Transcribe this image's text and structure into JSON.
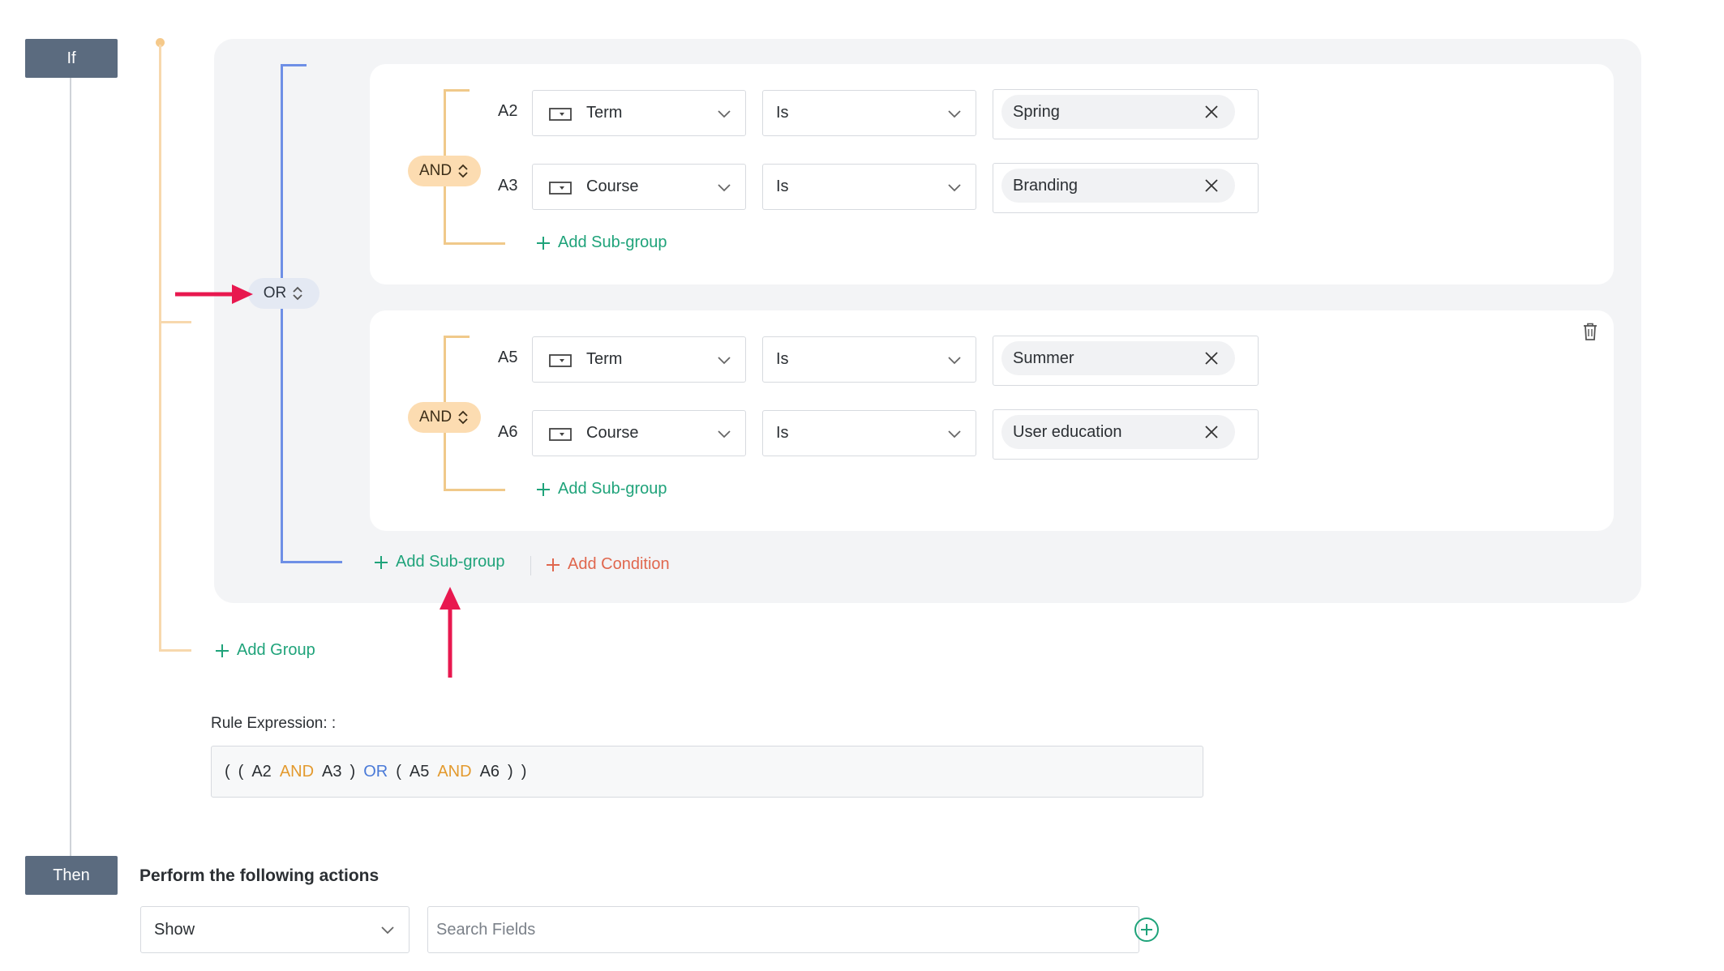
{
  "if_label": "If",
  "then_label": "Then",
  "or_operator": "OR",
  "groups": [
    {
      "operator": "AND",
      "conditions": [
        {
          "id": "A2",
          "field": "Term",
          "comparator": "Is",
          "value": "Spring"
        },
        {
          "id": "A3",
          "field": "Course",
          "comparator": "Is",
          "value": "Branding"
        }
      ],
      "add_subgroup": "Add Sub-group"
    },
    {
      "operator": "AND",
      "conditions": [
        {
          "id": "A5",
          "field": "Term",
          "comparator": "Is",
          "value": "Summer"
        },
        {
          "id": "A6",
          "field": "Course",
          "comparator": "Is",
          "value": "User education"
        }
      ],
      "add_subgroup": "Add Sub-group"
    }
  ],
  "outer_add_subgroup": "Add Sub-group",
  "add_condition": "Add Condition",
  "add_group": "Add Group",
  "rule_expression": {
    "label": "Rule Expression: :",
    "tokens": [
      "(",
      "(",
      "A2",
      "AND",
      "A3",
      ")",
      "OR",
      "(",
      "A5",
      "AND",
      "A6",
      ")",
      ")"
    ]
  },
  "actions": {
    "title": "Perform the following actions",
    "action_select": "Show",
    "search_placeholder": "Search Fields"
  },
  "colors": {
    "accent_green": "#1fa37a",
    "accent_red": "#e0674e",
    "and_orange": "#e39a2e",
    "or_blue": "#4a7ad8",
    "annotation_arrow": "#e8184f"
  }
}
